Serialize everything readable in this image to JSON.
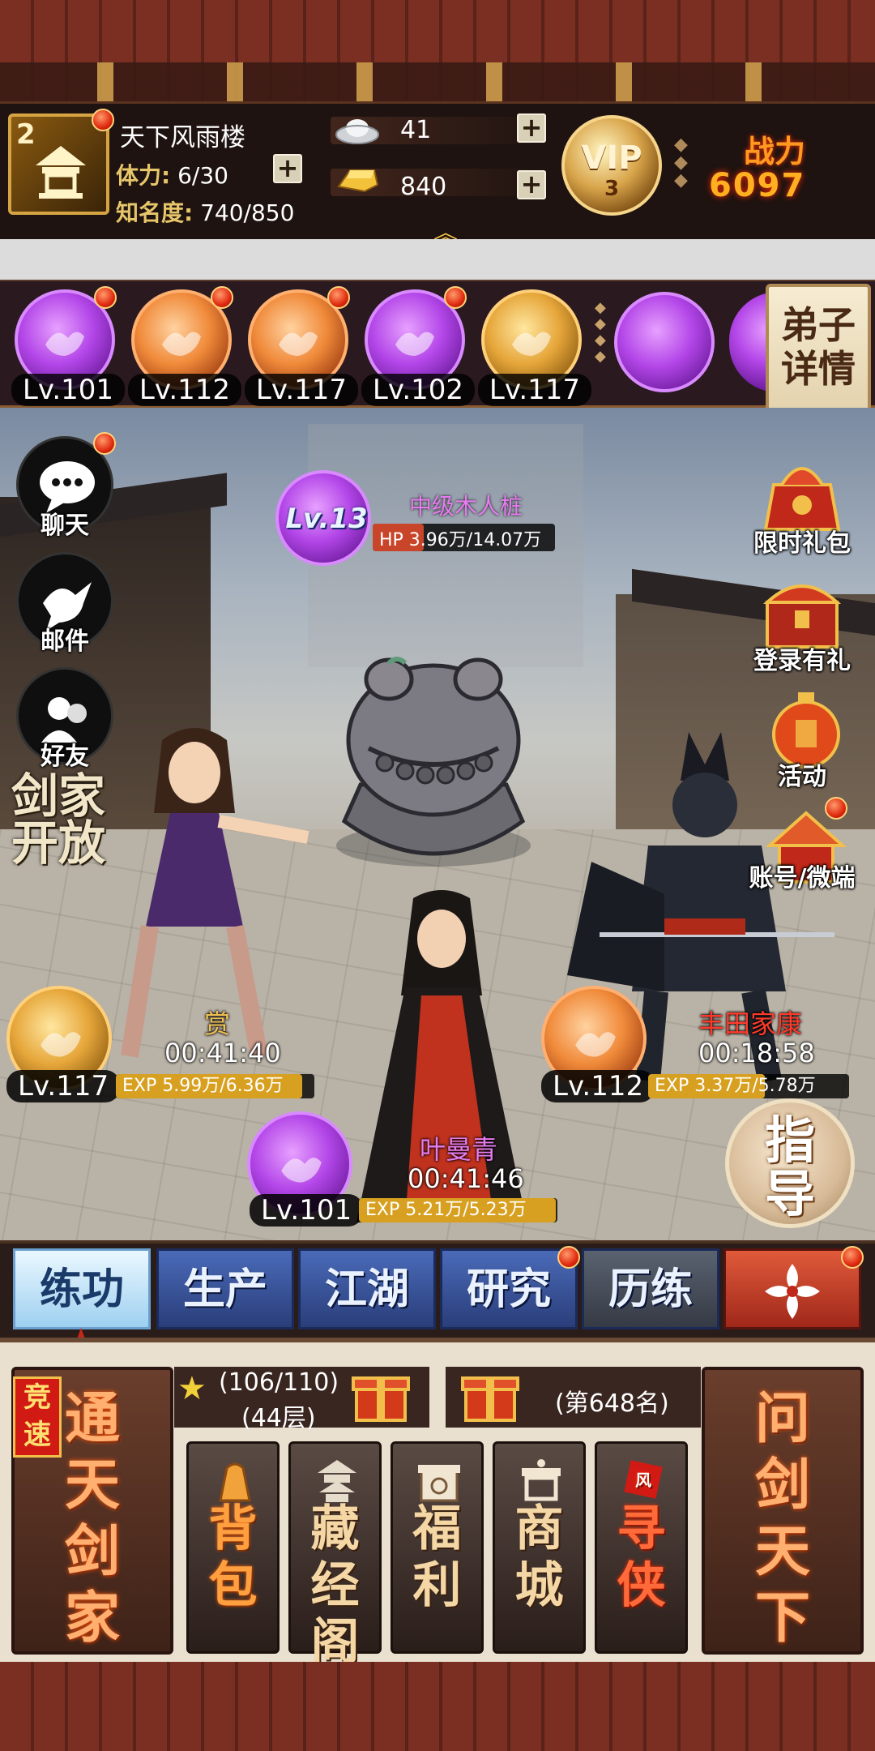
{
  "header": {
    "level": "2",
    "guild_name": "天下风雨楼",
    "stamina_label": "体力:",
    "stamina_value": "6/30",
    "fame_label": "知名度:",
    "fame_value": "740/850",
    "silver": "41",
    "gold": "840",
    "vip_label": "VIP",
    "vip_level": "3",
    "power_label": "战力",
    "power_value": "6097"
  },
  "disciples": [
    {
      "lv": "Lv.101",
      "color": "purple",
      "dot": true
    },
    {
      "lv": "Lv.112",
      "color": "orange",
      "dot": true
    },
    {
      "lv": "Lv.117",
      "color": "orange",
      "dot": true
    },
    {
      "lv": "Lv.102",
      "color": "purple",
      "dot": true
    },
    {
      "lv": "Lv.117",
      "color": "gold",
      "dot": false
    }
  ],
  "detail_button": "弟子详情",
  "left_menu": {
    "chat": "聊天",
    "mail": "邮件",
    "friends": "好友",
    "jianjia": "剑家开放"
  },
  "right_menu": {
    "gift": "限时礼包",
    "login": "登录有礼",
    "activity": "活动",
    "account": "账号/微端"
  },
  "target": {
    "level": "Lv.13",
    "name": "中级木人桩",
    "hp_text": "HP 3.96万/14.07万",
    "hp_fraction": 0.28
  },
  "heroes": [
    {
      "name": "赏",
      "time": "00:41:40",
      "lv": "Lv.117",
      "exp": "EXP 5.99万/6.36万",
      "exp_fraction": 0.94,
      "name_color": "#f0c050"
    },
    {
      "name": "丰田家康",
      "time": "00:18:58",
      "lv": "Lv.112",
      "exp": "EXP 3.37万/5.78万",
      "exp_fraction": 0.58,
      "name_color": "#ff3a2a"
    },
    {
      "name": "叶曼青",
      "time": "00:41:46",
      "lv": "Lv.101",
      "exp": "EXP 5.21万/5.23万",
      "exp_fraction": 0.99,
      "name_color": "#e77cf0"
    }
  ],
  "guide_button": "指导",
  "tabs": {
    "practice": "练功",
    "produce": "生产",
    "jianghu": "江湖",
    "research": "研究",
    "training": "历练"
  },
  "panel": {
    "speed_badge": "竞速",
    "tongtian": "通天剑家",
    "progress": "(106/110)",
    "floor": "(44层)",
    "rank": "(第648名)",
    "bag": "背包",
    "library": "藏经阁",
    "welfare": "福利",
    "shop": "商城",
    "seek": "寻侠",
    "wenjian": "问剑天下"
  },
  "colors": {
    "accent_gold": "#e7c66a",
    "notify_red": "#e02a10",
    "tab_blue": "#2a3e7a"
  }
}
